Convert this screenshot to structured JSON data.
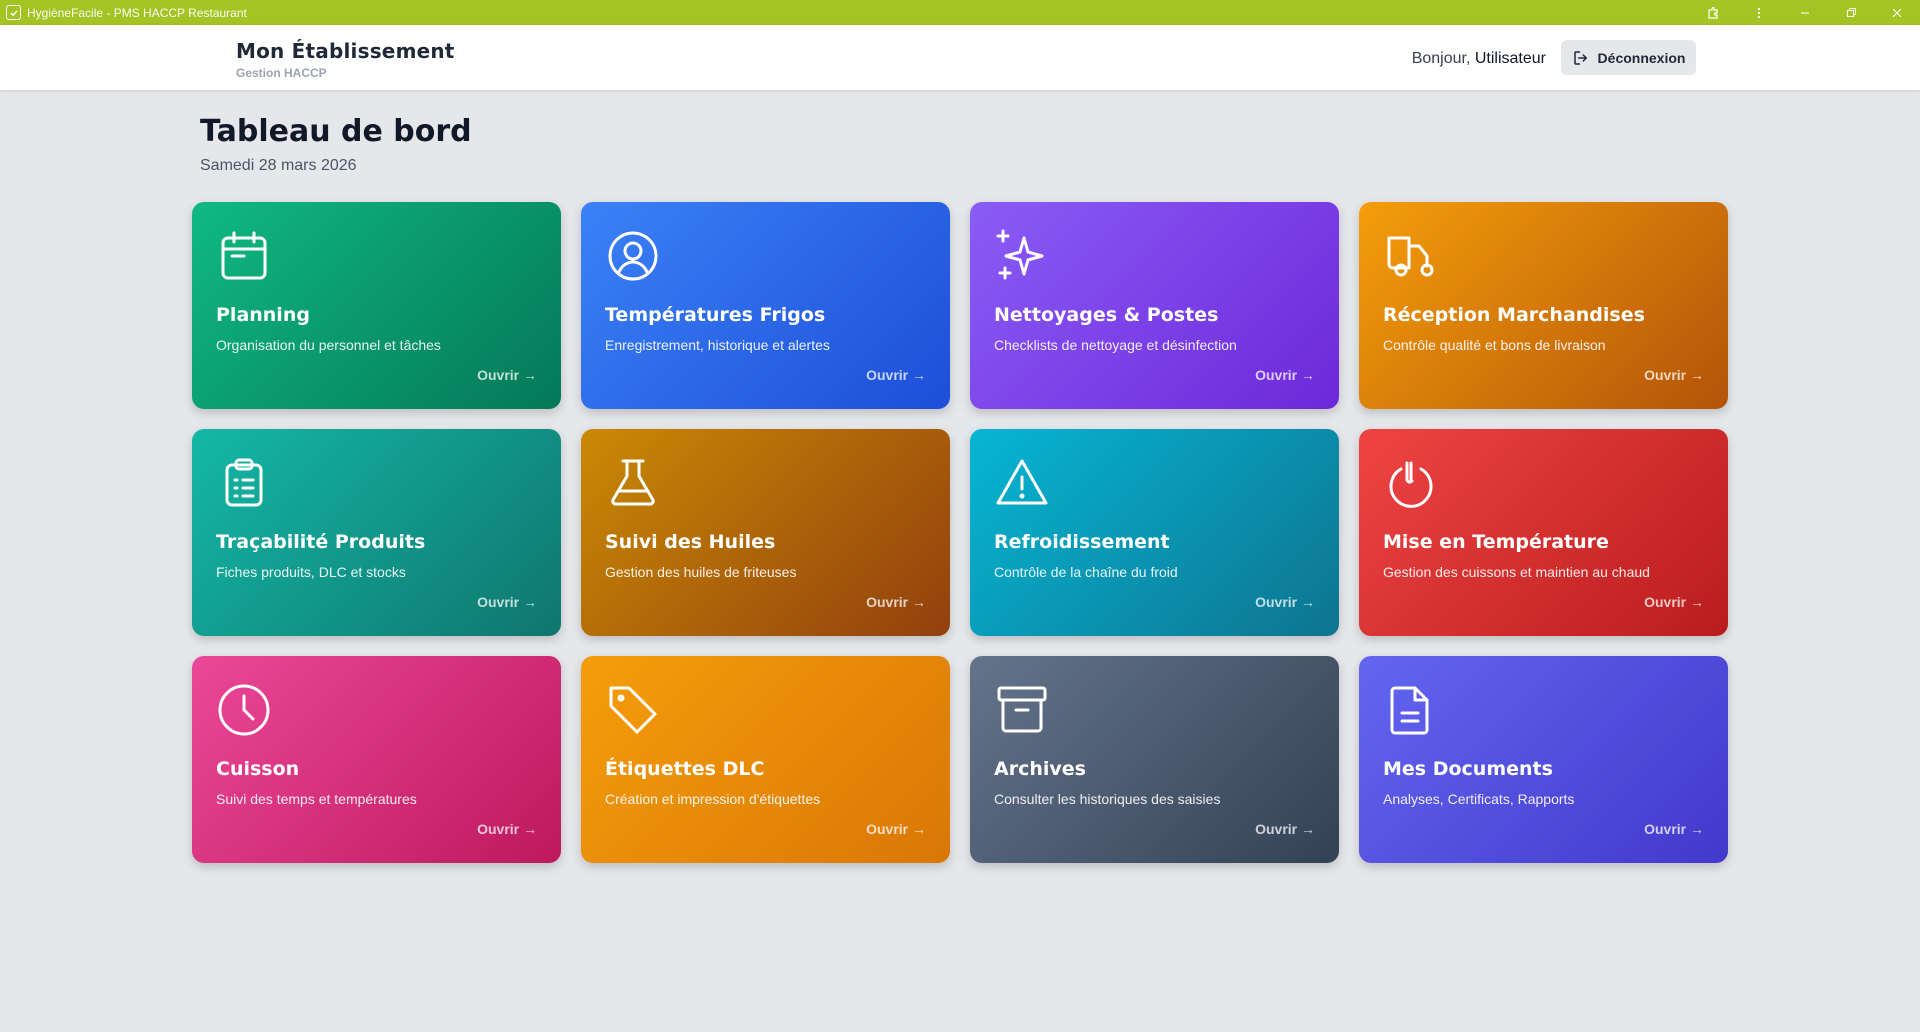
{
  "window": {
    "title": "HygièneFacile - PMS HACCP Restaurant",
    "bar_color": "#a3c423",
    "icons": [
      "app-icon",
      "extension-icon",
      "more-icon",
      "minimize-icon",
      "restore-icon",
      "close-icon"
    ]
  },
  "header": {
    "brand_name": "Mon Établissement",
    "brand_sub": "Gestion HACCP",
    "greeting": "Bonjour,",
    "user_name": "Utilisateur",
    "logout_label": "Déconnexion"
  },
  "page": {
    "title": "Tableau de bord",
    "date": "Samedi 28 mars 2026"
  },
  "cards": [
    {
      "title": "Planning",
      "desc": "Organisation du personnel et tâches",
      "open": "Ouvrir →",
      "icon": "calendar-icon",
      "color": "#10b981"
    },
    {
      "title": "Températures Frigos",
      "desc": "Enregistrement, historique et alertes",
      "open": "Ouvrir →",
      "icon": "user-circle-icon",
      "color": "#3b82f6"
    },
    {
      "title": "Nettoyages & Postes",
      "desc": "Checklists de nettoyage et désinfection",
      "open": "Ouvrir →",
      "icon": "sparkles-icon",
      "color": "#8b5cf6"
    },
    {
      "title": "Réception Marchandises",
      "desc": "Contrôle qualité et bons de livraison",
      "open": "Ouvrir →",
      "icon": "truck-icon",
      "color": "#f59e0b"
    },
    {
      "title": "Traçabilité Produits",
      "desc": "Fiches produits, DLC et stocks",
      "open": "Ouvrir →",
      "icon": "clipboard-list-icon",
      "color": "#14b8a6"
    },
    {
      "title": "Suivi des Huiles",
      "desc": "Gestion des huiles de friteuses",
      "open": "Ouvrir →",
      "icon": "flask-icon",
      "color": "#ca8a04"
    },
    {
      "title": "Refroidissement",
      "desc": "Contrôle de la chaîne du froid",
      "open": "Ouvrir →",
      "icon": "warning-triangle-icon",
      "color": "#06b6d4"
    },
    {
      "title": "Mise en Température",
      "desc": "Gestion des cuissons et maintien au chaud",
      "open": "Ouvrir →",
      "icon": "power-icon",
      "color": "#ef4444"
    },
    {
      "title": "Cuisson",
      "desc": "Suivi des temps et températures",
      "open": "Ouvrir →",
      "icon": "clock-icon",
      "color": "#ec4899"
    },
    {
      "title": "Étiquettes DLC",
      "desc": "Création et impression d'étiquettes",
      "open": "Ouvrir →",
      "icon": "tag-icon",
      "color": "#f59e0b"
    },
    {
      "title": "Archives",
      "desc": "Consulter les historiques des saisies",
      "open": "Ouvrir →",
      "icon": "archive-box-icon",
      "color": "#64748b"
    },
    {
      "title": "Mes Documents",
      "desc": "Analyses, Certificats, Rapports",
      "open": "Ouvrir →",
      "icon": "document-icon",
      "color": "#6366f1"
    }
  ]
}
